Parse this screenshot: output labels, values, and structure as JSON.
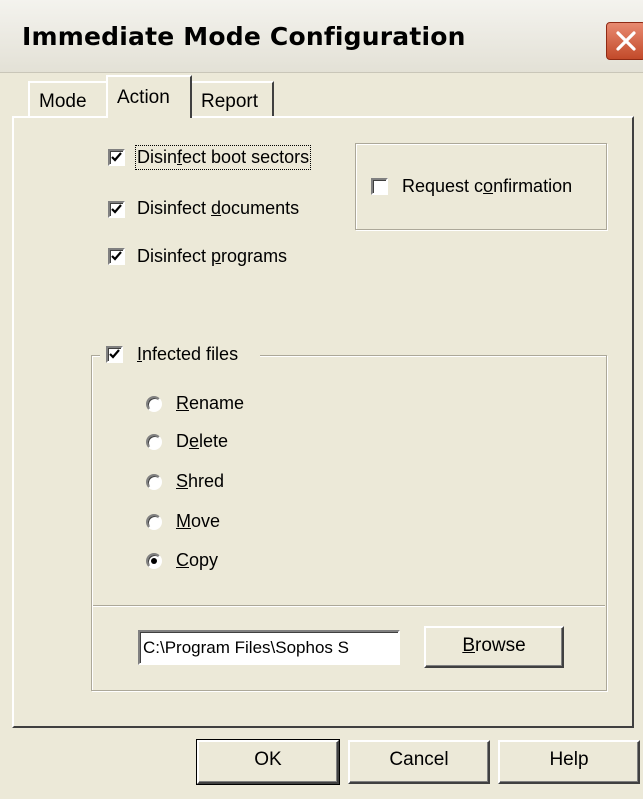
{
  "window": {
    "title": "Immediate Mode Configuration",
    "close_icon": "close-icon"
  },
  "tabs": [
    {
      "label": "Mode",
      "active": false
    },
    {
      "label": "Action",
      "active": true
    },
    {
      "label": "Report",
      "active": false
    }
  ],
  "action": {
    "disinfect_boot": {
      "pre": "Disin",
      "key": "f",
      "post": "ect boot sectors",
      "checked": true
    },
    "disinfect_documents": {
      "pre": "Disinfect ",
      "key": "d",
      "post": "ocuments",
      "checked": true
    },
    "disinfect_programs": {
      "pre": "Disinfect ",
      "key": "p",
      "post": "rograms",
      "checked": true
    },
    "request_confirmation": {
      "pre": "Request c",
      "key": "o",
      "post": "nfirmation",
      "checked": false
    },
    "infected_files": {
      "pre": "",
      "key": "I",
      "post": "nfected files",
      "checked": true
    },
    "radios": [
      {
        "pre": "",
        "key": "R",
        "post": "ename",
        "selected": false
      },
      {
        "pre": "D",
        "key": "e",
        "post": "lete",
        "selected": false
      },
      {
        "pre": "",
        "key": "S",
        "post": "hred",
        "selected": false
      },
      {
        "pre": "",
        "key": "M",
        "post": "ove",
        "selected": false
      },
      {
        "pre": "",
        "key": "C",
        "post": "opy",
        "selected": true
      }
    ],
    "path_value": "C:\\Program Files\\Sophos S",
    "browse": {
      "pre": "",
      "key": "B",
      "post": "rowse"
    }
  },
  "buttons": {
    "ok": "OK",
    "cancel": "Cancel",
    "help": "Help"
  },
  "colors": {
    "dialog_bg": "#ECE9D8",
    "close_button": "#C24A2A"
  }
}
